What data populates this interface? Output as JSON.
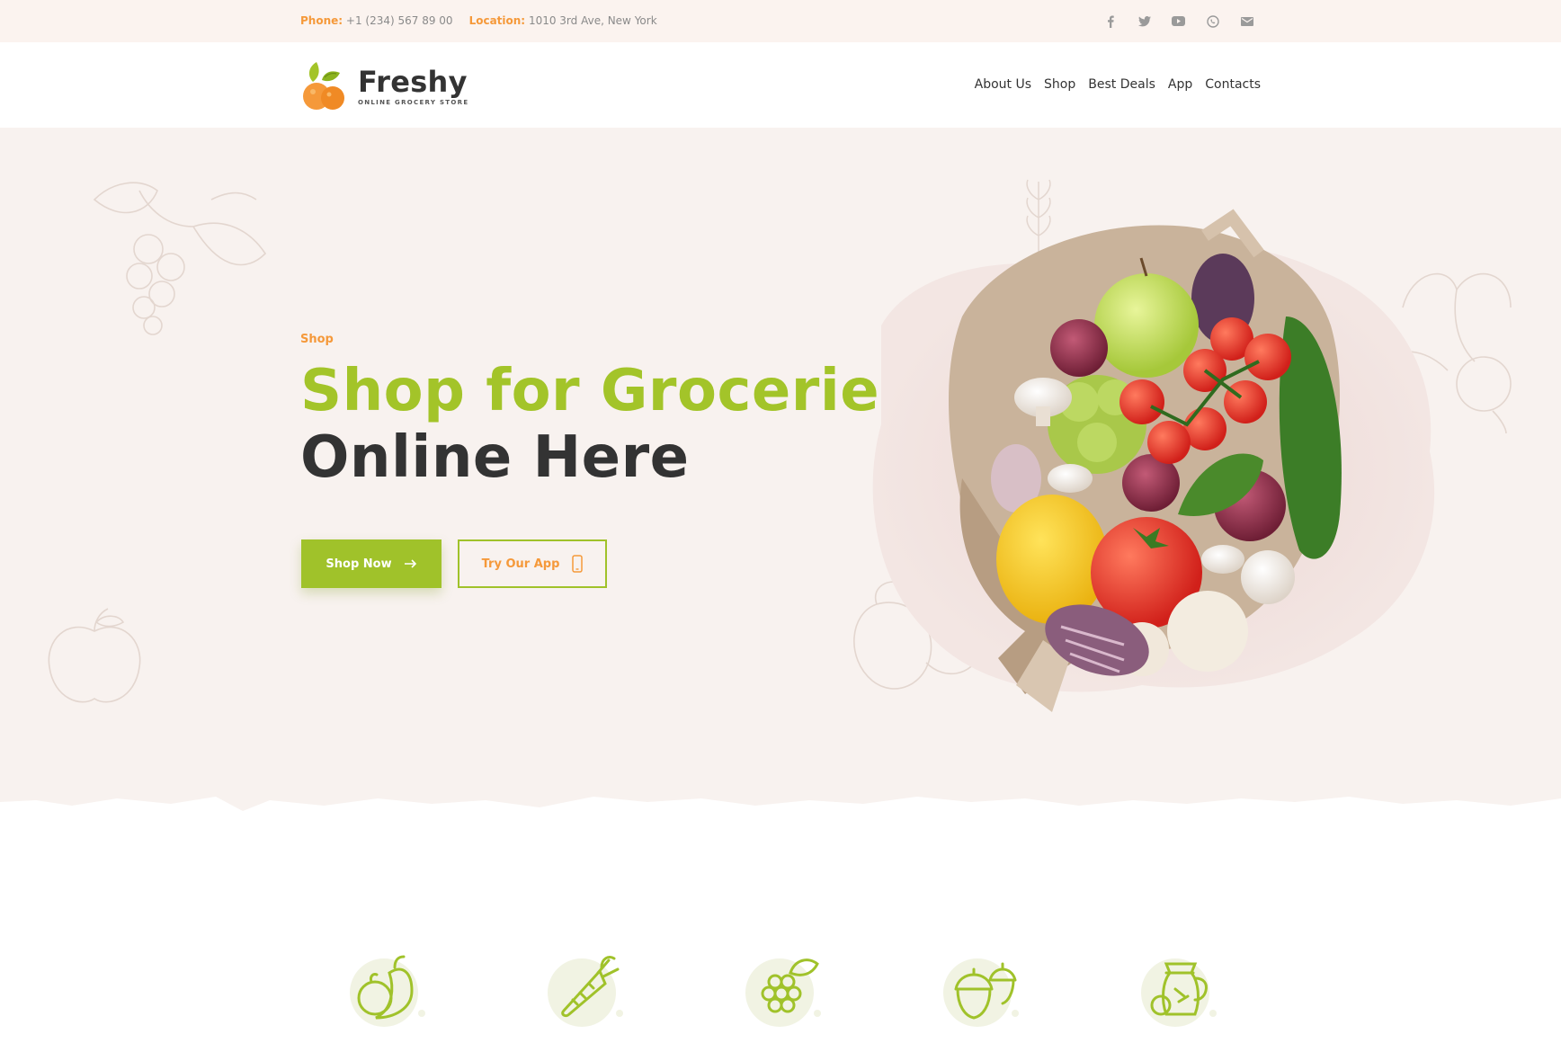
{
  "topbar": {
    "phone_label": "Phone:",
    "phone_value": "+1 (234) 567 89 00",
    "location_label": "Location:",
    "location_value": "1010 3rd Ave, New York",
    "social_icons": [
      "facebook-icon",
      "twitter-icon",
      "youtube-icon",
      "whatsapp-icon",
      "mail-icon"
    ]
  },
  "header": {
    "brand": "Freshy",
    "tagline": "ONLINE GROCERY STORE",
    "nav": [
      "About Us",
      "Shop",
      "Best Deals",
      "App",
      "Contacts"
    ]
  },
  "hero": {
    "eyebrow": "Shop",
    "title_line1": "Shop for Groceries",
    "title_line2": "Online Here",
    "primary_button": "Shop Now",
    "secondary_button": "Try Our App"
  },
  "categories": {
    "icons": [
      "vegetables-icon",
      "carrot-icon",
      "grapes-icon",
      "nuts-icon",
      "juice-jug-icon"
    ]
  },
  "colors": {
    "accent_green": "#a0c22a",
    "accent_orange": "#f5993a",
    "hero_bg": "#f8f2ef",
    "topbar_bg": "#fbf3ef"
  }
}
